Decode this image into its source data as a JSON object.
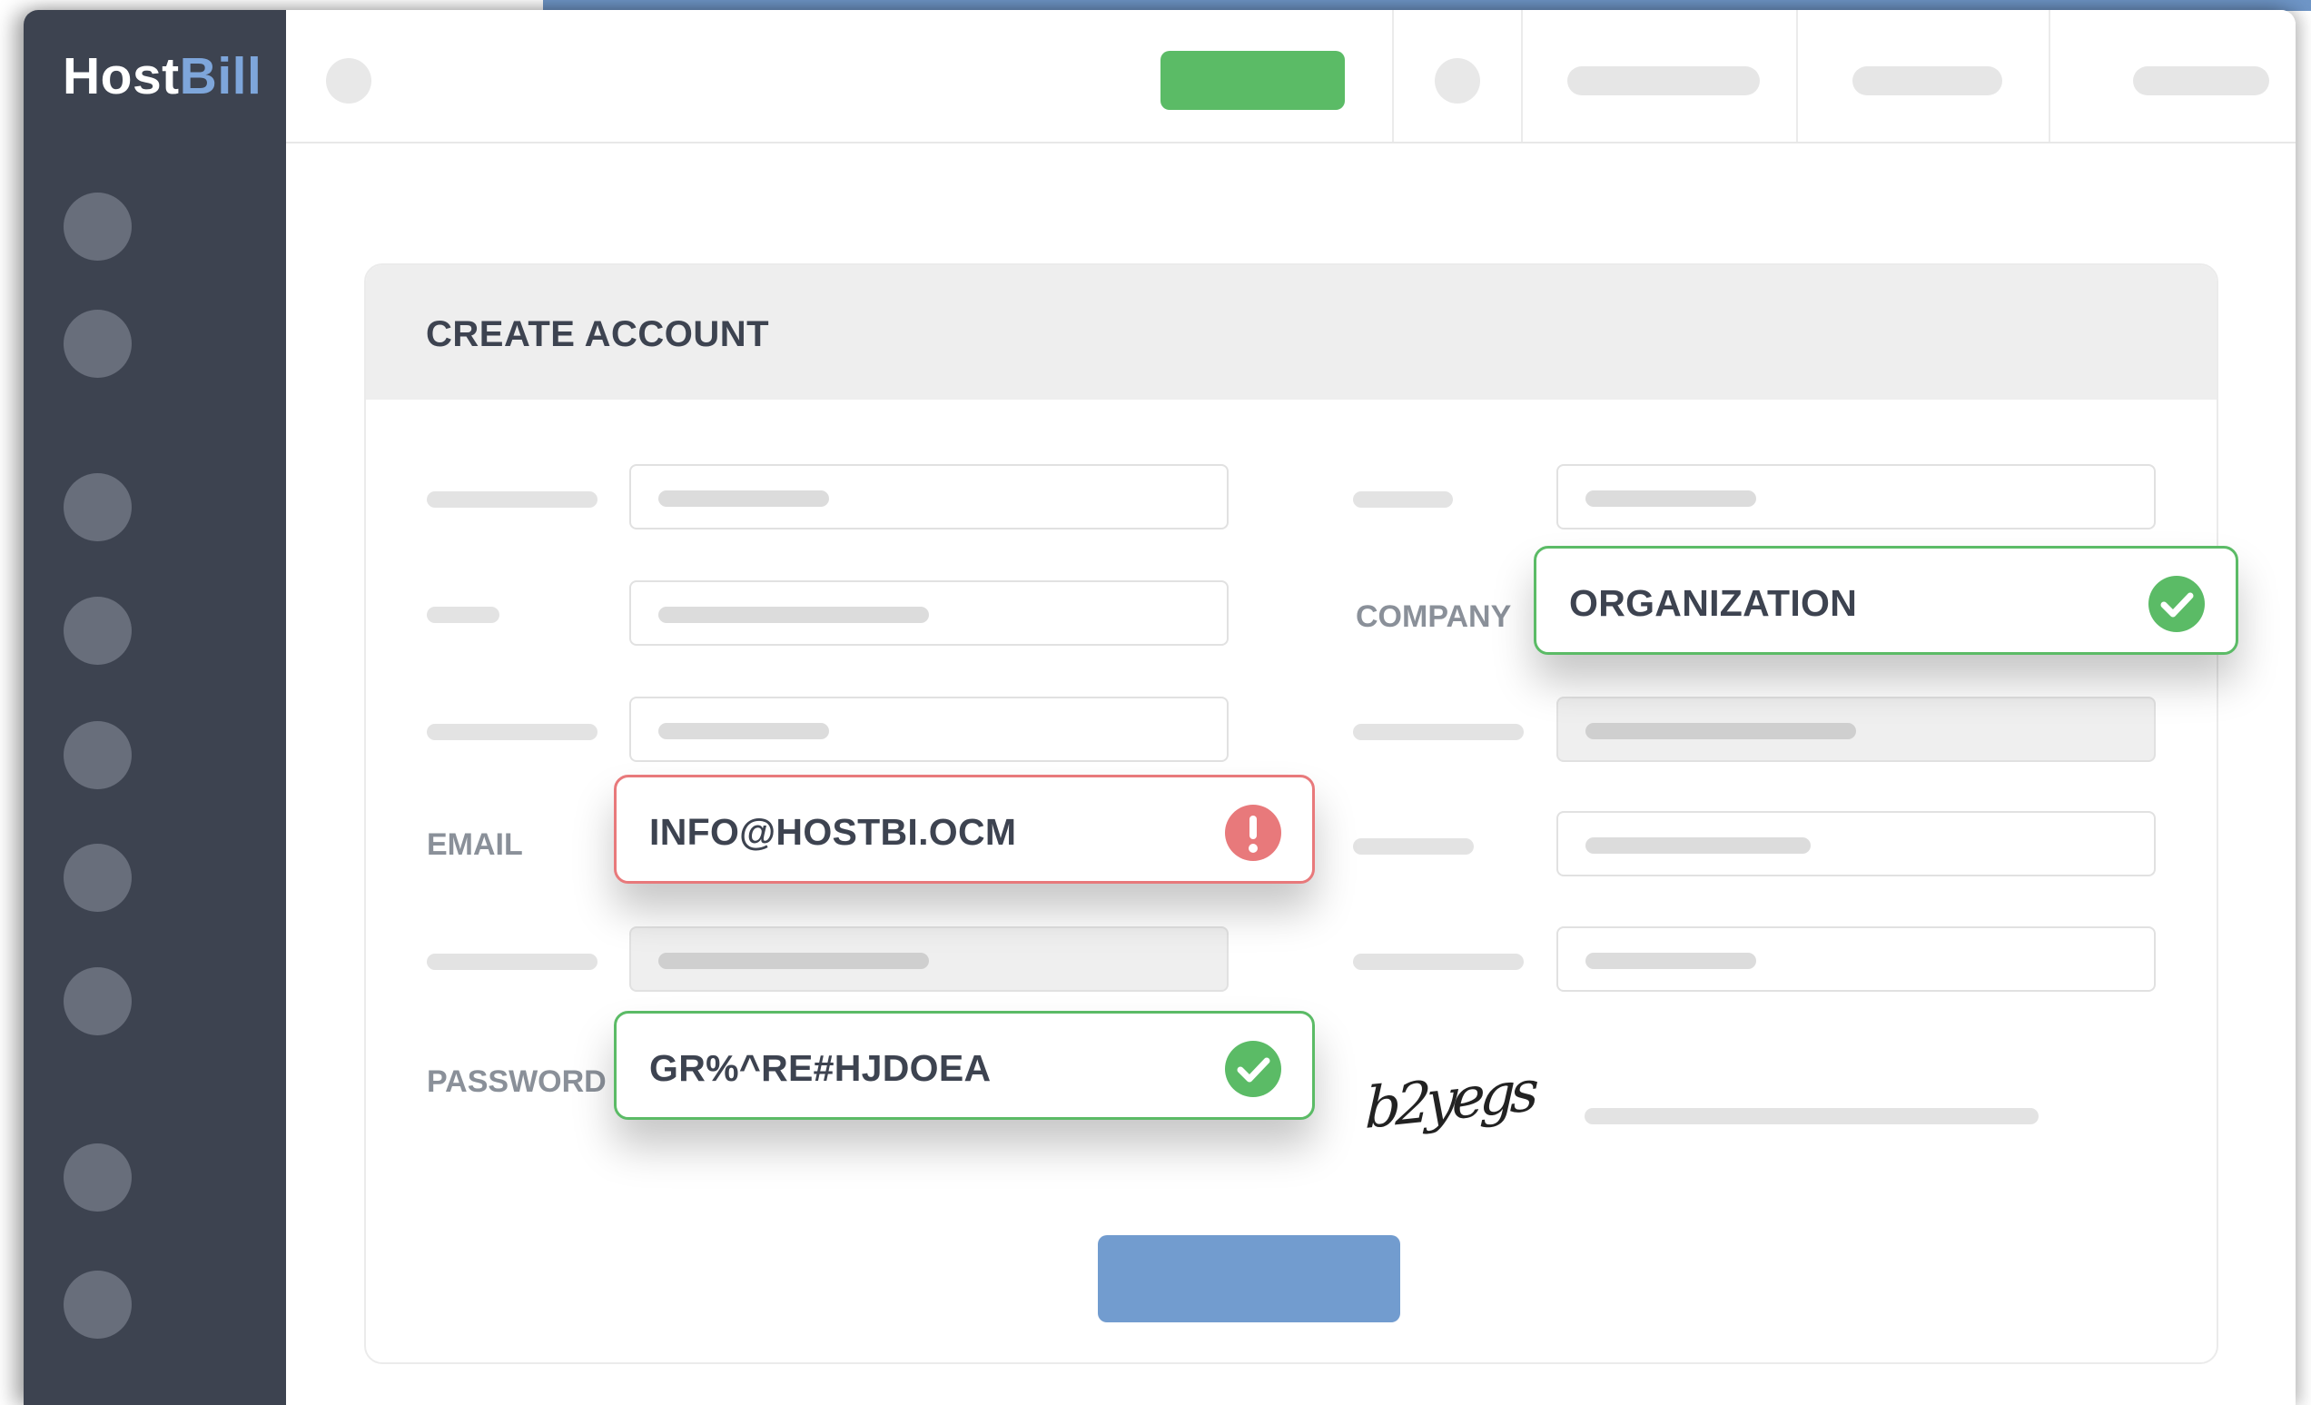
{
  "app": {
    "logo_part1": "Host",
    "logo_part2": "Bill"
  },
  "form": {
    "title": "CREATE ACCOUNT",
    "company": {
      "label": "COMPANY",
      "value": "ORGANIZATION",
      "status": "valid"
    },
    "email": {
      "label": "EMAIL",
      "value": "INFO@HOSTBI.OCM",
      "status": "error"
    },
    "password": {
      "label": "PASSWORD",
      "value": "GR%^RE#HJDOEA",
      "status": "valid"
    },
    "captcha": {
      "text": "b2yegs"
    }
  },
  "colors": {
    "sidebar": "#3d4350",
    "accent_blue": "#729ccf",
    "success_green": "#5bbb66",
    "error_red": "#e8797b"
  },
  "icons": {
    "valid": "check-circle-icon",
    "error": "exclamation-circle-icon"
  }
}
